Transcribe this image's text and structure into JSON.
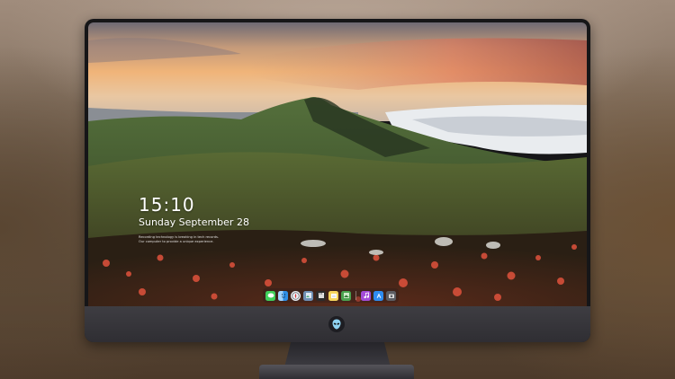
{
  "lock_screen": {
    "time": "15:10",
    "date": "Sunday September 28",
    "notice_line1": "Recording technology is breaking in tech records.",
    "notice_line2": "Our computer to provide a unique experience."
  },
  "dock": {
    "apps": [
      {
        "name": "messages",
        "icon": "messages-icon",
        "color": "#3fcf5a"
      },
      {
        "name": "finder",
        "icon": "finder-icon",
        "color": "#2f8fe8"
      },
      {
        "name": "safari",
        "icon": "safari-icon",
        "color": "#e9eef3"
      },
      {
        "name": "preview",
        "icon": "preview-icon",
        "color": "#6f8fb4"
      },
      {
        "name": "clapper",
        "icon": "clapper-icon",
        "color": "#2b2b2b"
      },
      {
        "name": "notes",
        "icon": "notes-icon",
        "color": "#f6d55c"
      },
      {
        "name": "photos",
        "icon": "photos-icon",
        "color": "#4aa34f"
      },
      {
        "name": "music",
        "icon": "music-icon",
        "color": "#a44bd8"
      },
      {
        "name": "app-store",
        "icon": "app-store-icon",
        "color": "#2e8cf0"
      },
      {
        "name": "camera",
        "icon": "camera-icon",
        "color": "#5c5d63"
      }
    ]
  }
}
